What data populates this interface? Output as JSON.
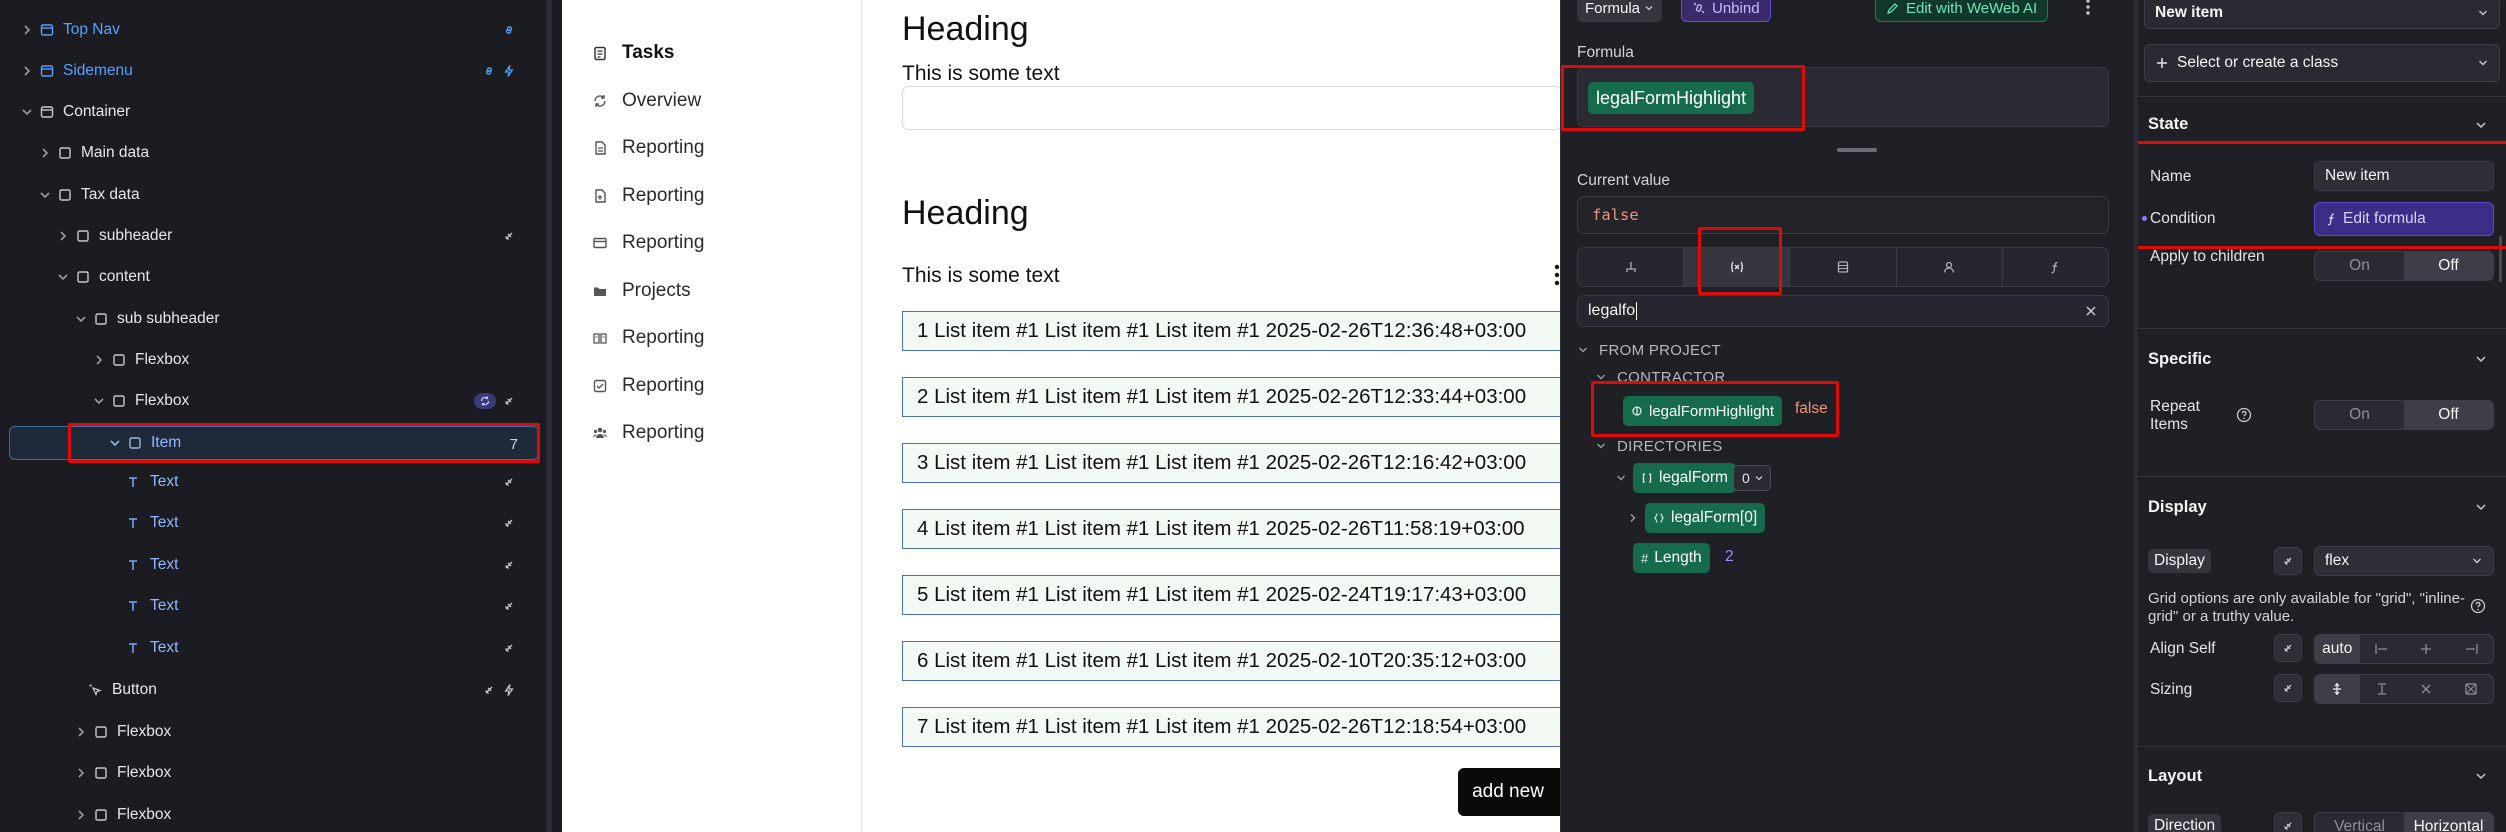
{
  "layers": {
    "items": [
      {
        "label": "Top Nav"
      },
      {
        "label": "Sidemenu"
      },
      {
        "label": "Container"
      },
      {
        "label": "Main data"
      },
      {
        "label": "Tax data"
      },
      {
        "label": "subheader"
      },
      {
        "label": "content"
      },
      {
        "label": "sub subheader"
      },
      {
        "label": "Flexbox"
      },
      {
        "label": "Flexbox"
      },
      {
        "label": "Item",
        "count": "7"
      },
      {
        "label": "Text"
      },
      {
        "label": "Text"
      },
      {
        "label": "Text"
      },
      {
        "label": "Text"
      },
      {
        "label": "Text"
      },
      {
        "label": "Button"
      },
      {
        "label": "Flexbox"
      },
      {
        "label": "Flexbox"
      },
      {
        "label": "Flexbox"
      }
    ]
  },
  "canvas": {
    "nav": [
      "Tasks",
      "Overview",
      "Reporting",
      "Reporting",
      "Reporting",
      "Projects",
      "Reporting",
      "Reporting",
      "Reporting"
    ],
    "heading1": "Heading",
    "text1": "This is some text",
    "heading2": "Heading",
    "text2": "This is some text",
    "list_items": [
      "1 List item #1 List item #1 List item #1 2025-02-26T12:36:48+03:00",
      "2 List item #1 List item #1 List item #1 2025-02-26T12:33:44+03:00",
      "3 List item #1 List item #1 List item #1 2025-02-26T12:16:42+03:00",
      "4 List item #1 List item #1 List item #1 2025-02-26T11:58:19+03:00",
      "5 List item #1 List item #1 List item #1 2025-02-24T19:17:43+03:00",
      "6 List item #1 List item #1 List item #1 2025-02-10T20:35:12+03:00",
      "7 List item #1 List item #1 List item #1 2025-02-26T12:18:54+03:00"
    ],
    "add_button": "add new"
  },
  "formula_panel": {
    "mode": "Formula",
    "unbind": "Unbind",
    "edit_ai": "Edit with WeWeb AI",
    "label": "Formula",
    "formula_tag": "legalFormHighlight",
    "current_value_label": "Current value",
    "current_value": "false",
    "search_value": "legalfo",
    "from_project": "FROM PROJECT",
    "contractor": "CONTRACTOR",
    "var_name": "legalFormHighlight",
    "var_value": "false",
    "directories": "DIRECTORIES",
    "array_name": "legalForm",
    "array_index": "0",
    "array_item": "legalForm[0]",
    "length_label": "Length",
    "length_value": "2"
  },
  "props": {
    "item_select": "New item",
    "class_button": "Select or create a class",
    "state": {
      "title": "State",
      "name_label": "Name",
      "name_value": "New item",
      "condition_label": "Condition",
      "condition_button": "Edit formula",
      "apply_label": "Apply to children",
      "on": "On",
      "off": "Off"
    },
    "specific": {
      "title": "Specific",
      "repeat_label": "Repeat Items",
      "on": "On",
      "off": "Off"
    },
    "display": {
      "title": "Display",
      "display_label": "Display",
      "display_value": "flex",
      "grid_note": "Grid options are only available for \"grid\", \"inline-grid\" or a truthy value.",
      "align_label": "Align Self",
      "align_value": "auto",
      "sizing_label": "Sizing"
    },
    "layout": {
      "title": "Layout",
      "direction_label": "Direction",
      "vertical": "Vertical",
      "horizontal": "Horizontal"
    }
  }
}
